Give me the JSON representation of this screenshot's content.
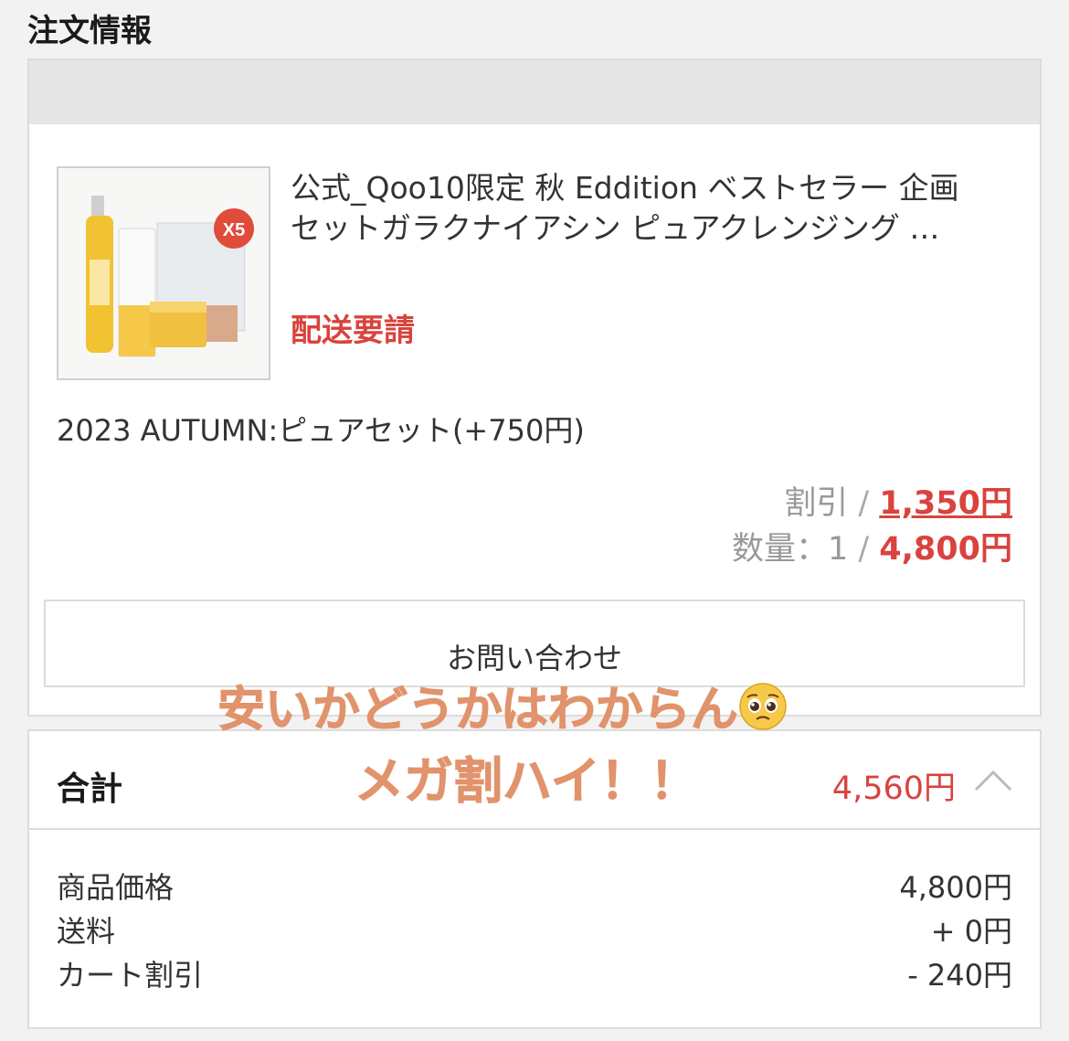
{
  "section_title": "注文情報",
  "order": {
    "shop_name": "",
    "product_name_line1": "公式_Qoo10限定 秋 Eddition ベストセラー 企画",
    "product_name_line2": "セットガラクナイアシン ピュアクレンジング …",
    "status": "配送要請",
    "option": "2023 AUTUMN:ピュアセット(+750円)",
    "discount_label": "割引",
    "discount_sep": " / ",
    "discount_value": "1,350円",
    "quantity_label": "数量：1",
    "quantity_sep": " / ",
    "quantity_price": "4,800円",
    "thumb_badge": "X5",
    "inquiry_label": "お問い合わせ"
  },
  "total": {
    "label": "合計",
    "amount": "4,560円",
    "rows": [
      {
        "key": "商品価格",
        "value": "4,800円"
      },
      {
        "key": "送料",
        "value": "+ 0円"
      },
      {
        "key": "カート割引",
        "value": "- 240円"
      }
    ]
  },
  "overlay_text": {
    "line1": "安いかどうかはわからん",
    "line2": "メガ割ハイ！！"
  },
  "colors": {
    "accent_red": "#d9433e",
    "overlay_orange": "#e1936b"
  }
}
